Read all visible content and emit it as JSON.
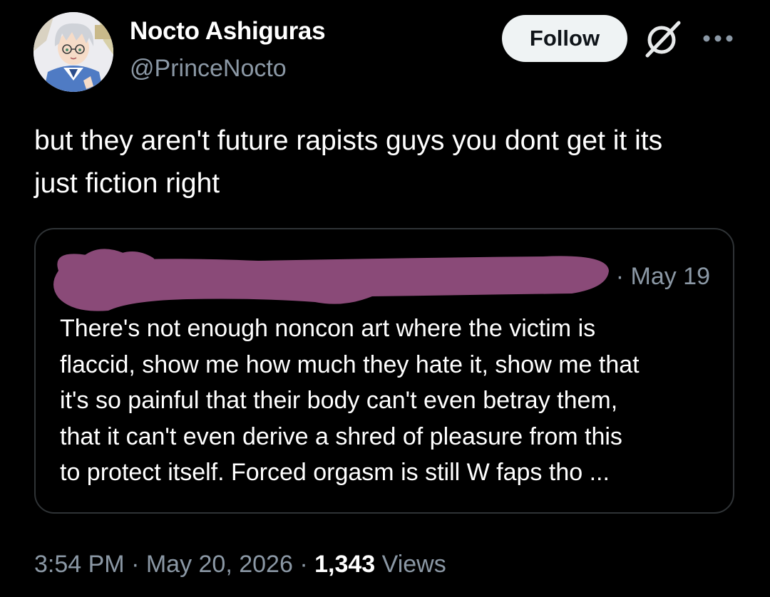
{
  "author": {
    "display_name": "Nocto Ashiguras",
    "handle": "@PrinceNocto",
    "avatar_icon": "anime-character-avatar"
  },
  "header_actions": {
    "follow_label": "Follow",
    "grok_icon": "grok-icon",
    "more_icon": "more-dots-icon"
  },
  "tweet": {
    "text": "but they aren't future rapists guys you dont get it its\njust fiction right"
  },
  "quoted_tweet": {
    "author_redacted": true,
    "redaction_color": "#8a4a78",
    "date": "· May 19",
    "text": "There's not enough noncon art where the victim is\nflaccid, show me how much they hate it, show me that\nit's so painful that their body can't even betray them,\nthat it can't even derive a shred of pleasure from this\nto protect itself. Forced orgasm is still W faps tho ..."
  },
  "meta": {
    "time": "3:54 PM",
    "separator": " · ",
    "date": "May 20, 2026",
    "views_count": "1,343",
    "views_label": " Views"
  },
  "colors": {
    "background": "#000000",
    "text_primary": "#ffffff",
    "text_secondary": "#8b98a5",
    "border": "#2f3336",
    "follow_button_bg": "#eff3f4"
  }
}
